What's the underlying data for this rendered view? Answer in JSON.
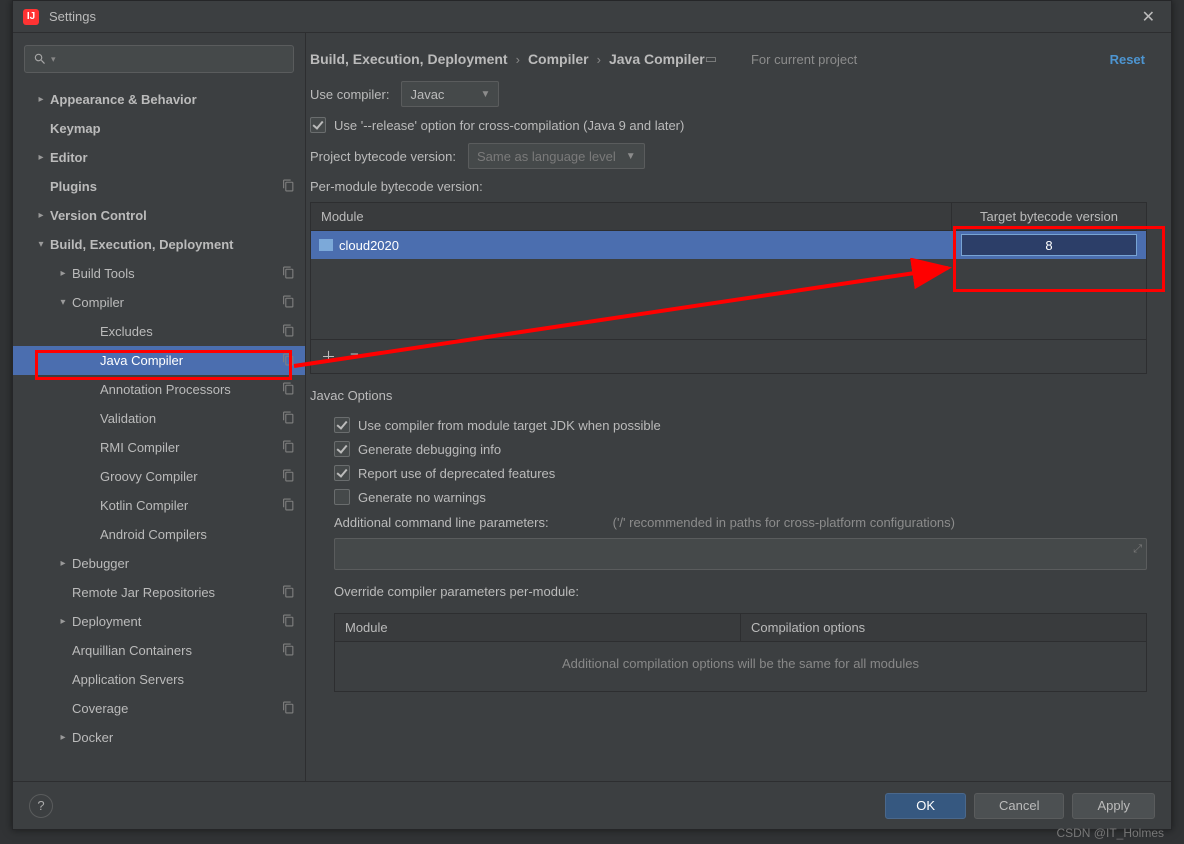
{
  "window": {
    "title": "Settings"
  },
  "breadcrumb": [
    "Build, Execution, Deployment",
    "Compiler",
    "Java Compiler"
  ],
  "scope_label": "For current project",
  "reset_label": "Reset",
  "sidebar": [
    {
      "label": "Appearance & Behavior",
      "depth": 0,
      "arrow": "right",
      "bold": true
    },
    {
      "label": "Keymap",
      "depth": 0,
      "arrow": "",
      "bold": true
    },
    {
      "label": "Editor",
      "depth": 0,
      "arrow": "right",
      "bold": true
    },
    {
      "label": "Plugins",
      "depth": 0,
      "arrow": "",
      "bold": true,
      "copy": true
    },
    {
      "label": "Version Control",
      "depth": 0,
      "arrow": "right",
      "bold": true
    },
    {
      "label": "Build, Execution, Deployment",
      "depth": 0,
      "arrow": "down",
      "bold": true
    },
    {
      "label": "Build Tools",
      "depth": 1,
      "arrow": "right",
      "copy": true
    },
    {
      "label": "Compiler",
      "depth": 1,
      "arrow": "down",
      "copy": true
    },
    {
      "label": "Excludes",
      "depth": 2,
      "arrow": "",
      "copy": true
    },
    {
      "label": "Java Compiler",
      "depth": 2,
      "arrow": "",
      "copy": true,
      "selected": true
    },
    {
      "label": "Annotation Processors",
      "depth": 2,
      "arrow": "",
      "copy": true
    },
    {
      "label": "Validation",
      "depth": 2,
      "arrow": "",
      "copy": true
    },
    {
      "label": "RMI Compiler",
      "depth": 2,
      "arrow": "",
      "copy": true
    },
    {
      "label": "Groovy Compiler",
      "depth": 2,
      "arrow": "",
      "copy": true
    },
    {
      "label": "Kotlin Compiler",
      "depth": 2,
      "arrow": "",
      "copy": true
    },
    {
      "label": "Android Compilers",
      "depth": 2,
      "arrow": ""
    },
    {
      "label": "Debugger",
      "depth": 1,
      "arrow": "right"
    },
    {
      "label": "Remote Jar Repositories",
      "depth": 1,
      "arrow": "",
      "copy": true
    },
    {
      "label": "Deployment",
      "depth": 1,
      "arrow": "right",
      "copy": true
    },
    {
      "label": "Arquillian Containers",
      "depth": 1,
      "arrow": "",
      "copy": true
    },
    {
      "label": "Application Servers",
      "depth": 1,
      "arrow": ""
    },
    {
      "label": "Coverage",
      "depth": 1,
      "arrow": "",
      "copy": true
    },
    {
      "label": "Docker",
      "depth": 1,
      "arrow": "right"
    }
  ],
  "compiler": {
    "use_compiler_label": "Use compiler:",
    "use_compiler_value": "Javac",
    "release_option": {
      "checked": true,
      "label": "Use '--release' option for cross-compilation (Java 9 and later)"
    },
    "project_bytecode_label": "Project bytecode version:",
    "project_bytecode_value": "Same as language level",
    "per_module_label": "Per-module bytecode version:",
    "table": {
      "header_module": "Module",
      "header_target": "Target bytecode version",
      "module": "cloud2020",
      "target": "8"
    },
    "javac_title": "Javac Options",
    "opts": [
      {
        "checked": true,
        "label": "Use compiler from module target JDK when possible"
      },
      {
        "checked": true,
        "label": "Generate debugging info"
      },
      {
        "checked": true,
        "label": "Report use of deprecated features"
      },
      {
        "checked": false,
        "label": "Generate no warnings"
      }
    ],
    "addl_label": "Additional command line parameters:",
    "addl_hint": "('/' recommended in paths for cross-platform configurations)",
    "override_label": "Override compiler parameters per-module:",
    "override_header_module": "Module",
    "override_header_opts": "Compilation options",
    "override_empty": "Additional compilation options will be the same for all modules"
  },
  "footer": {
    "ok": "OK",
    "cancel": "Cancel",
    "apply": "Apply"
  },
  "watermark": "CSDN @IT_Holmes"
}
